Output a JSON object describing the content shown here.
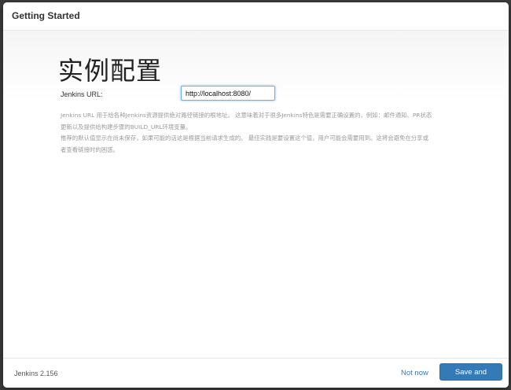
{
  "header": {
    "title": "Getting Started"
  },
  "main": {
    "heading": "实例配置",
    "url_label": "Jenkins URL:",
    "url_value": "http://localhost:8080/",
    "help_lines": [
      "Jenkins URL 用于给各种Jenkins资源提供绝对路径链接的根地址。 这意味着对于很多Jenkins特色是需要正确设置的，例如：邮件通知、PR状态",
      "更新以及提供给构建步骤的BUILD_URL环境变量。",
      "推荐的默认值显示在尚未保存，如果可能的话这是根据当前请求生成的。 最佳实践是要设置这个值，用户可能会需要用到。这将会避免在分享或",
      "者查看链接时的困惑。"
    ]
  },
  "footer": {
    "version": "Jenkins 2.156",
    "not_now_label": "Not now",
    "save_label": "Save and Finish"
  },
  "colors": {
    "primary": "#337ab7",
    "link": "#337ab7",
    "help_text": "#9a9a9a"
  }
}
